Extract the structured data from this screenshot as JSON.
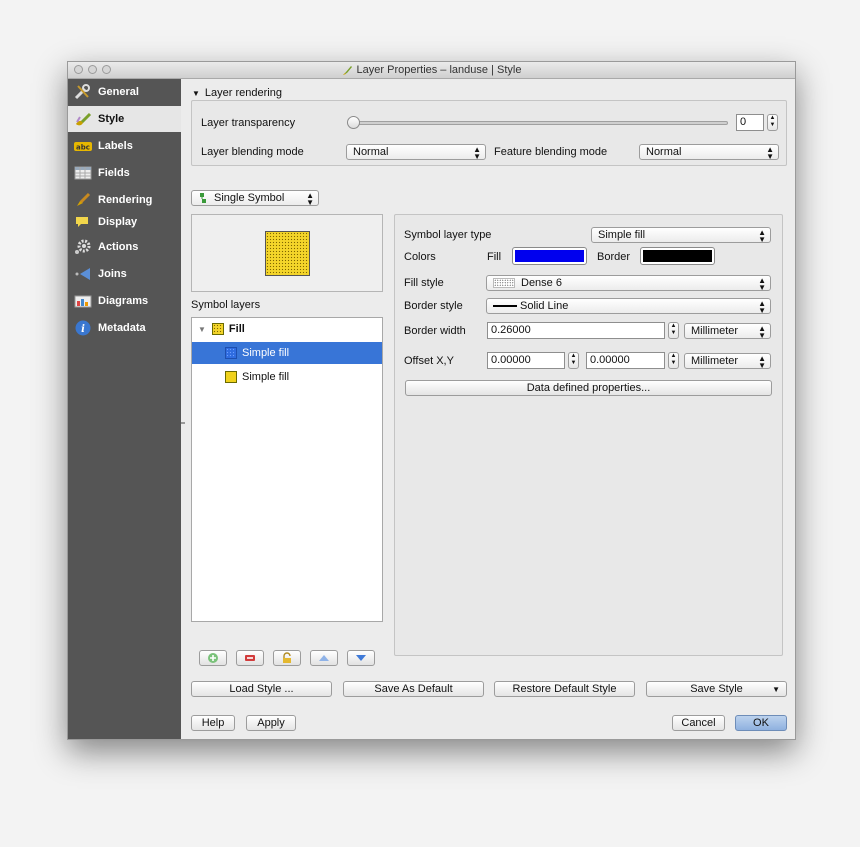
{
  "window": {
    "title": "Layer Properties – landuse | Style"
  },
  "sidebar": {
    "items": [
      {
        "label": "General",
        "icon": "wrench-icon"
      },
      {
        "label": "Style",
        "icon": "paintbrush-icon"
      },
      {
        "label": "Labels",
        "icon": "abc-icon"
      },
      {
        "label": "Fields",
        "icon": "table-icon"
      },
      {
        "label": "Rendering",
        "icon": "brush-icon"
      },
      {
        "label": "Display",
        "icon": "speech-bubble-icon"
      },
      {
        "label": "Actions",
        "icon": "gear-icon"
      },
      {
        "label": "Joins",
        "icon": "join-arrow-icon"
      },
      {
        "label": "Diagrams",
        "icon": "chart-icon"
      },
      {
        "label": "Metadata",
        "icon": "info-icon"
      }
    ],
    "active": "Style"
  },
  "layer_rendering": {
    "header": "Layer rendering",
    "transparency_label": "Layer transparency",
    "transparency_value": "0",
    "transparency_fraction": 0,
    "blending_label": "Layer blending mode",
    "blending_value": "Normal",
    "feature_blending_label": "Feature blending mode",
    "feature_blending_value": "Normal"
  },
  "renderer": {
    "value": "Single Symbol"
  },
  "symbol_layers": {
    "label": "Symbol layers",
    "items": [
      {
        "label": "Fill",
        "level": 0
      },
      {
        "label": "Simple fill",
        "level": 1,
        "selected": true
      },
      {
        "label": "Simple fill",
        "level": 1,
        "selected": false
      }
    ]
  },
  "symbol_props": {
    "layer_type_label": "Symbol layer type",
    "layer_type_value": "Simple fill",
    "colors_label": "Colors",
    "fill_label": "Fill",
    "fill_color": "#0000ee",
    "border_label": "Border",
    "border_color": "#000000",
    "fill_style_label": "Fill style",
    "fill_style_value": "Dense 6",
    "border_style_label": "Border style",
    "border_style_value": "Solid Line",
    "border_width_label": "Border width",
    "border_width_value": "0.26000",
    "border_width_unit": "Millimeter",
    "offset_label": "Offset X,Y",
    "offset_x": "0.00000",
    "offset_y": "0.00000",
    "offset_unit": "Millimeter",
    "data_defined_label": "Data defined properties..."
  },
  "buttons": {
    "load_style": "Load Style ...",
    "save_default": "Save As Default",
    "restore_default": "Restore Default Style",
    "save_style": "Save Style",
    "help": "Help",
    "apply": "Apply",
    "cancel": "Cancel",
    "ok": "OK"
  }
}
